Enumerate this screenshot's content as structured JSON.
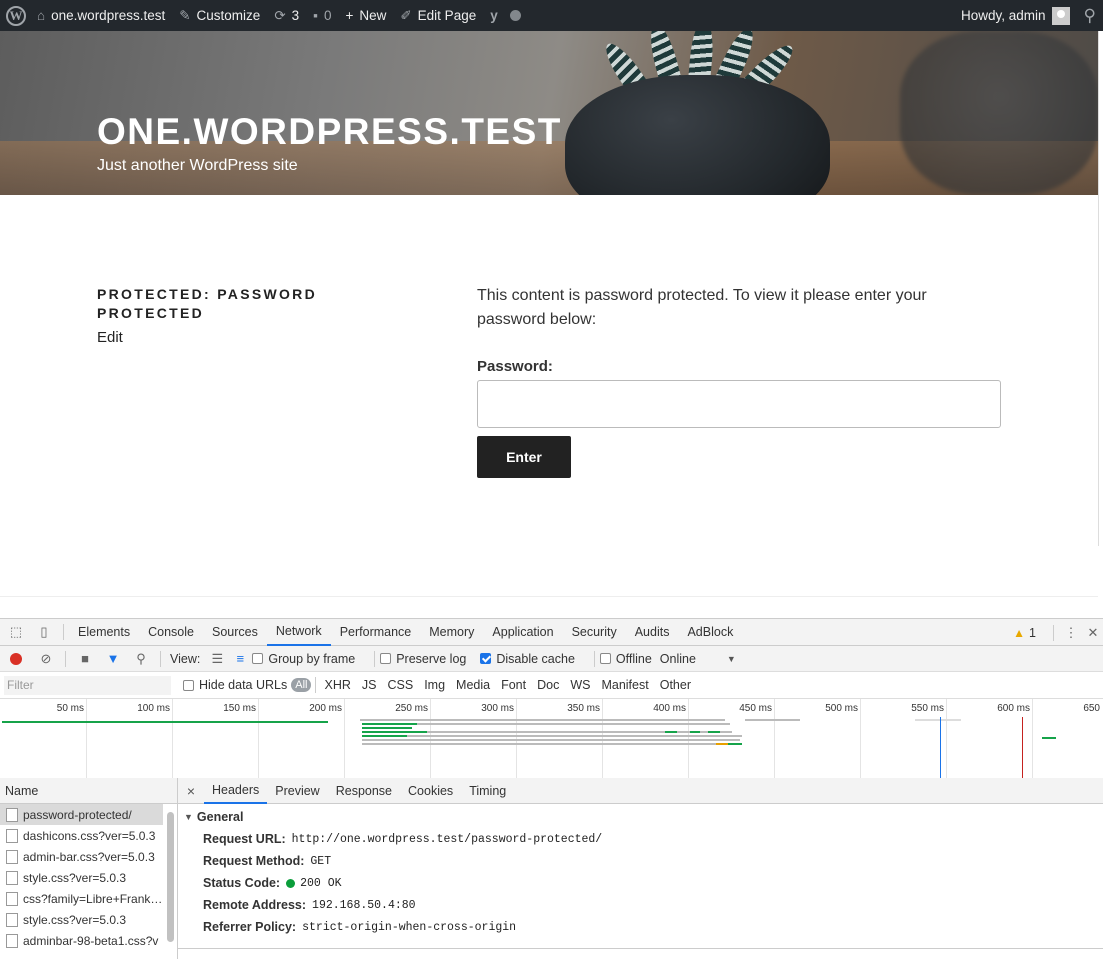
{
  "adminbar": {
    "site": "one.wordpress.test",
    "customize": "Customize",
    "updates_count": "3",
    "comments_count": "0",
    "new_label": "New",
    "edit_page": "Edit Page",
    "howdy": "Howdy, admin"
  },
  "header": {
    "site_title": "ONE.WORDPRESS.TEST",
    "tagline": "Just another WordPress site"
  },
  "post": {
    "title": "PROTECTED: PASSWORD PROTECTED",
    "edit_link": "Edit",
    "message": "This content is password protected. To view it please enter your password below:",
    "password_label": "Password:",
    "password_value": "",
    "submit_label": "Enter"
  },
  "devtools": {
    "tabs": [
      "Elements",
      "Console",
      "Sources",
      "Network",
      "Performance",
      "Memory",
      "Application",
      "Security",
      "Audits",
      "AdBlock"
    ],
    "active_tab": "Network",
    "warning_count": "1",
    "toolbar": {
      "view_label": "View:",
      "group_by_frame": "Group by frame",
      "preserve_log": "Preserve log",
      "disable_cache": "Disable cache",
      "offline": "Offline",
      "throttle": "Online"
    },
    "filter": {
      "placeholder": "Filter",
      "hide_data_urls": "Hide data URLs",
      "types": [
        "All",
        "XHR",
        "JS",
        "CSS",
        "Img",
        "Media",
        "Font",
        "Doc",
        "WS",
        "Manifest",
        "Other"
      ]
    },
    "timeline_ticks": [
      "50 ms",
      "100 ms",
      "150 ms",
      "200 ms",
      "250 ms",
      "300 ms",
      "350 ms",
      "400 ms",
      "450 ms",
      "500 ms",
      "550 ms",
      "600 ms",
      "650"
    ],
    "name_header": "Name",
    "requests": [
      "password-protected/",
      "dashicons.css?ver=5.0.3",
      "admin-bar.css?ver=5.0.3",
      "style.css?ver=5.0.3",
      "css?family=Libre+Frankli...",
      "style.css?ver=5.0.3",
      "adminbar-98-beta1.css?v"
    ],
    "detail_tabs": [
      "Headers",
      "Preview",
      "Response",
      "Cookies",
      "Timing"
    ],
    "general": {
      "title": "General",
      "request_url_label": "Request URL:",
      "request_url": "http://one.wordpress.test/password-protected/",
      "method_label": "Request Method:",
      "method": "GET",
      "status_label": "Status Code:",
      "status": "200 OK",
      "remote_label": "Remote Address:",
      "remote": "192.168.50.4:80",
      "referrer_label": "Referrer Policy:",
      "referrer": "strict-origin-when-cross-origin"
    }
  },
  "colors": {
    "adminbar_bg": "#23282d",
    "button_bg": "#222222",
    "devtools_accent": "#1a73e8",
    "record_red": "#d93025",
    "status_green": "#0a9d3a"
  }
}
